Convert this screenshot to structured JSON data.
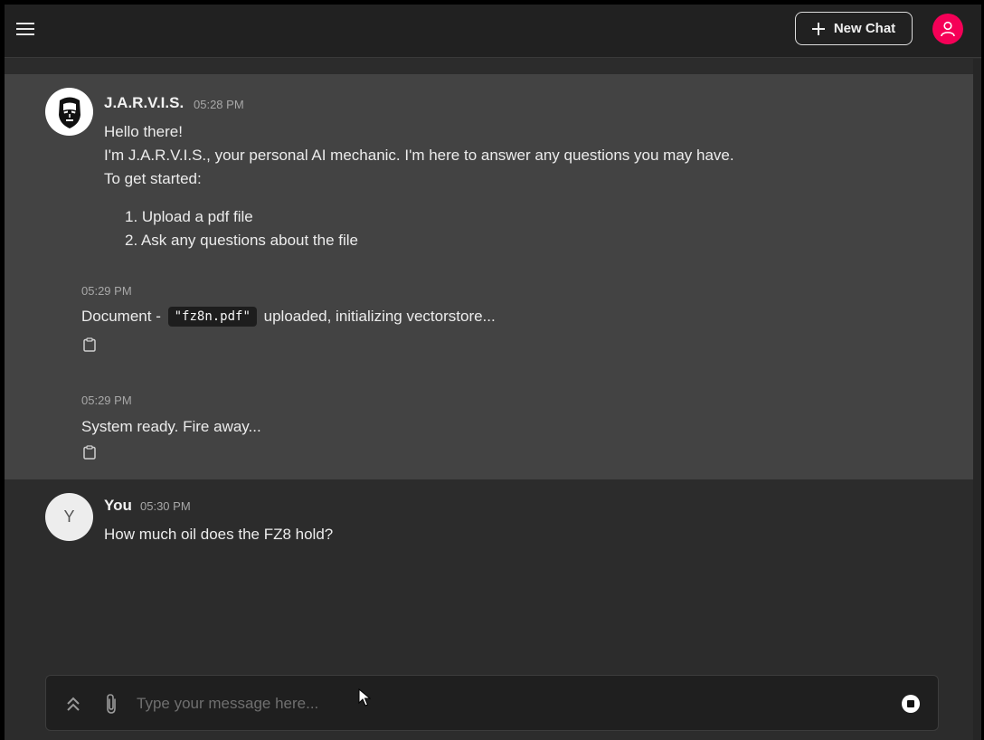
{
  "header": {
    "new_chat_label": "New Chat",
    "icons": {
      "menu": "menu-icon",
      "plus": "plus-icon",
      "user": "user-icon"
    },
    "accent_color": "#f50057"
  },
  "messages": [
    {
      "author": "J.A.R.V.I.S.",
      "time": "05:28 PM",
      "avatar_icon": "iron-man-helmet-icon",
      "lines": [
        "Hello there!",
        "I'm J.A.R.V.I.S., your personal AI mechanic. I'm here to answer any questions you may have.",
        "To get started:"
      ],
      "steps": [
        "1. Upload a pdf file",
        "2. Ask any questions about the file"
      ]
    },
    {
      "time": "05:29 PM",
      "text_before": "Document -",
      "code": "\"fz8n.pdf\"",
      "text_after": "uploaded, initializing vectorstore..."
    },
    {
      "time": "05:29 PM",
      "text": "System ready. Fire away..."
    },
    {
      "author": "You",
      "time": "05:30 PM",
      "avatar_letter": "Y",
      "text": "How much oil does the FZ8 hold?"
    }
  ],
  "composer": {
    "placeholder": "Type your message here...",
    "icons": {
      "expand": "double-chevron-up-icon",
      "attach": "paperclip-icon",
      "stop": "stop-icon"
    }
  }
}
